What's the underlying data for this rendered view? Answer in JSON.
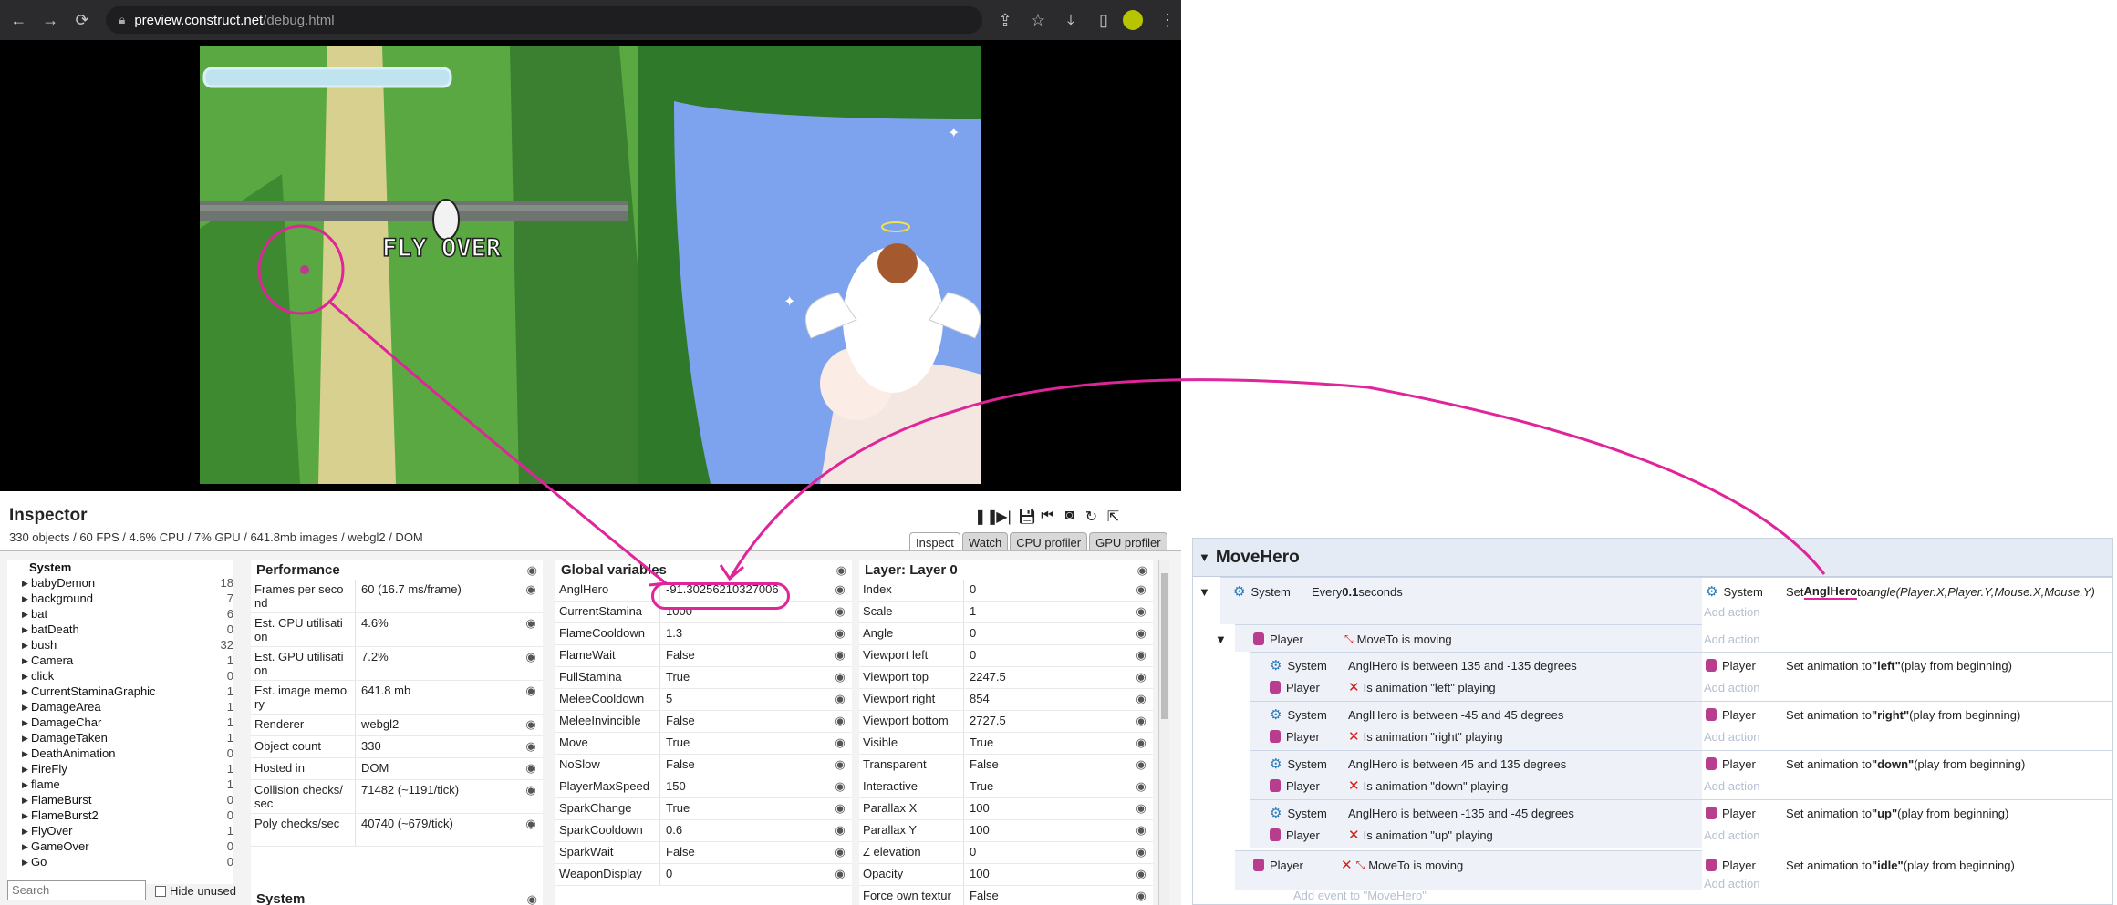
{
  "browser": {
    "url_host": "preview.construct.net",
    "url_path": "/debug.html"
  },
  "game": {
    "banner_text": "FLY OVER"
  },
  "inspector": {
    "title": "Inspector",
    "stats": "330 objects / 60 FPS / 4.6% CPU / 7% GPU / 641.8mb images / webgl2 / DOM",
    "tabs": [
      "Inspect",
      "Watch",
      "CPU profiler",
      "GPU profiler"
    ],
    "object_list": {
      "header": "System",
      "items": [
        {
          "name": "babyDemon",
          "count": "18"
        },
        {
          "name": "background",
          "count": "7"
        },
        {
          "name": "bat",
          "count": "6"
        },
        {
          "name": "batDeath",
          "count": "0"
        },
        {
          "name": "bush",
          "count": "32"
        },
        {
          "name": "Camera",
          "count": "1"
        },
        {
          "name": "click",
          "count": "0"
        },
        {
          "name": "CurrentStaminaGraphic",
          "count": "1"
        },
        {
          "name": "DamageArea",
          "count": "1"
        },
        {
          "name": "DamageChar",
          "count": "1"
        },
        {
          "name": "DamageTaken",
          "count": "1"
        },
        {
          "name": "DeathAnimation",
          "count": "0"
        },
        {
          "name": "FireFly",
          "count": "1"
        },
        {
          "name": "flame",
          "count": "1"
        },
        {
          "name": "FlameBurst",
          "count": "0"
        },
        {
          "name": "FlameBurst2",
          "count": "0"
        },
        {
          "name": "FlyOver",
          "count": "1"
        },
        {
          "name": "GameOver",
          "count": "0"
        },
        {
          "name": "Go",
          "count": "0"
        }
      ],
      "search_placeholder": "Search",
      "hide_unused": "Hide unused"
    },
    "performance": {
      "title": "Performance",
      "rows": [
        {
          "k": "Frames per seco nd",
          "v": "60 (16.7 ms/frame)"
        },
        {
          "k": "Est. CPU utilisati on",
          "v": "4.6%"
        },
        {
          "k": "Est. GPU utilisati on",
          "v": "7.2%"
        },
        {
          "k": "Est. image memo ry",
          "v": "641.8 mb"
        },
        {
          "k": "Renderer",
          "v": "webgl2"
        },
        {
          "k": "Object count",
          "v": "330"
        },
        {
          "k": "Hosted in",
          "v": "DOM"
        },
        {
          "k": "Collision checks/ sec",
          "v": "71482 (~1191/tick)"
        },
        {
          "k": "Poly checks/sec",
          "v": "40740 (~679/tick)"
        }
      ],
      "system_title": "System"
    },
    "globals": {
      "title": "Global variables",
      "rows": [
        {
          "k": "AnglHero",
          "v": "-91.30256210327006"
        },
        {
          "k": "CurrentStamina",
          "v": "1000"
        },
        {
          "k": "FlameCooldown",
          "v": "1.3"
        },
        {
          "k": "FlameWait",
          "v": "False"
        },
        {
          "k": "FullStamina",
          "v": "True"
        },
        {
          "k": "MeleeCooldown",
          "v": "5"
        },
        {
          "k": "MeleeInvincible",
          "v": "False"
        },
        {
          "k": "Move",
          "v": "True"
        },
        {
          "k": "NoSlow",
          "v": "False"
        },
        {
          "k": "PlayerMaxSpeed",
          "v": "150"
        },
        {
          "k": "SparkChange",
          "v": "True"
        },
        {
          "k": "SparkCooldown",
          "v": "0.6"
        },
        {
          "k": "SparkWait",
          "v": "False"
        },
        {
          "k": "WeaponDisplay",
          "v": "0"
        }
      ]
    },
    "layer": {
      "title": "Layer: Layer 0",
      "rows": [
        {
          "k": "Index",
          "v": "0"
        },
        {
          "k": "Scale",
          "v": "1"
        },
        {
          "k": "Angle",
          "v": "0"
        },
        {
          "k": "Viewport left",
          "v": "0"
        },
        {
          "k": "Viewport top",
          "v": "2247.5"
        },
        {
          "k": "Viewport right",
          "v": "854"
        },
        {
          "k": "Viewport bottom",
          "v": "2727.5"
        },
        {
          "k": "Visible",
          "v": "True"
        },
        {
          "k": "Transparent",
          "v": "False"
        },
        {
          "k": "Interactive",
          "v": "True"
        },
        {
          "k": "Parallax X",
          "v": "100"
        },
        {
          "k": "Parallax Y",
          "v": "100"
        },
        {
          "k": "Z elevation",
          "v": "0"
        },
        {
          "k": "Opacity",
          "v": "100"
        },
        {
          "k": "Force own textur",
          "v": "False"
        }
      ]
    }
  },
  "events": {
    "group": "MoveHero",
    "e1": {
      "obj": "System",
      "cond_pre": "Every ",
      "cond_b": "0.1",
      "cond_post": " seconds",
      "act_obj": "System",
      "act_pre": "Set ",
      "act_b": "AnglHero",
      "act_mid": " to ",
      "act_it": "angle(Player.X,Player.Y,Mouse.X,Mouse.Y)"
    },
    "e2": {
      "obj": "Player",
      "cond": "MoveTo is moving"
    },
    "sub": [
      {
        "c1": "AnglHero is between 135 and -135 degrees",
        "c2": "Is animation \"left\" playing",
        "anim": "\"left\""
      },
      {
        "c1": "AnglHero is between -45 and 45 degrees",
        "c2": "Is animation \"right\" playing",
        "anim": "\"right\""
      },
      {
        "c1": "AnglHero is between 45 and 135 degrees",
        "c2": "Is animation \"down\" playing",
        "anim": "\"down\""
      },
      {
        "c1": "AnglHero is between -135 and -45 degrees",
        "c2": "Is animation \"up\" playing",
        "anim": "\"up\""
      }
    ],
    "e_last": {
      "obj": "Player",
      "cond": "MoveTo is moving",
      "anim": "\"idle\""
    },
    "sys": "System",
    "player": "Player",
    "set_anim": "Set animation to ",
    "play_from": " (play from beginning)",
    "add_action": "Add action",
    "add_event": "Add event to \"MoveHero\""
  },
  "colors": {
    "annotation": "#e0249a",
    "accent": "#2b7bb9"
  }
}
